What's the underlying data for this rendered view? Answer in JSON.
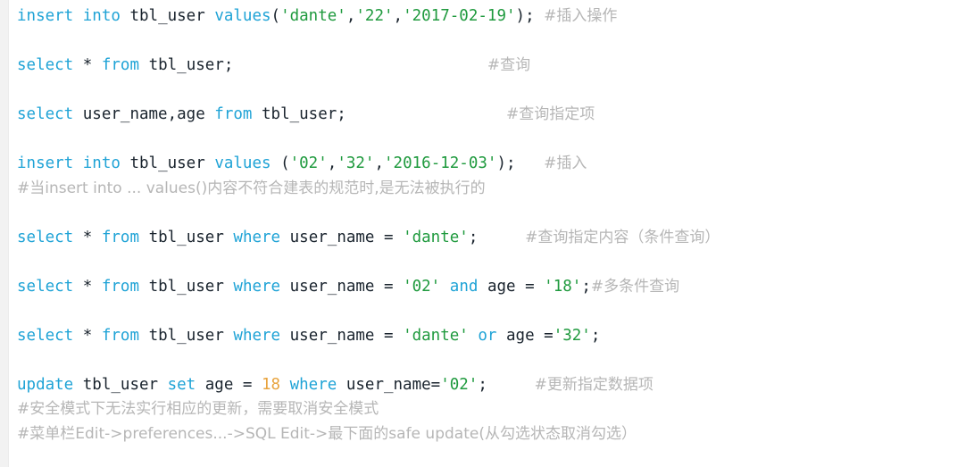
{
  "editor": {
    "language": "sql",
    "colors": {
      "keyword": "#1fa3d6",
      "identifier": "#19232d",
      "string": "#1f9a3e",
      "number": "#e8a33d",
      "comment": "#b6b6b6",
      "background": "#ffffff",
      "gutter": "#f2f2f2"
    }
  },
  "lines": [
    {
      "n": 1,
      "text": "insert into tbl_user values('dante','22','2017-02-19');   #插入操作",
      "tokens": [
        {
          "t": "insert",
          "k": "kw"
        },
        {
          "t": " ",
          "k": "op"
        },
        {
          "t": "into",
          "k": "kw"
        },
        {
          "t": " ",
          "k": "op"
        },
        {
          "t": "tbl_user",
          "k": "id"
        },
        {
          "t": " ",
          "k": "op"
        },
        {
          "t": "values",
          "k": "kw"
        },
        {
          "t": "(",
          "k": "punc"
        },
        {
          "t": "'dante'",
          "k": "str"
        },
        {
          "t": ",",
          "k": "punc"
        },
        {
          "t": "'22'",
          "k": "str"
        },
        {
          "t": ",",
          "k": "punc"
        },
        {
          "t": "'2017-02-19'",
          "k": "str"
        },
        {
          "t": ");",
          "k": "punc"
        },
        {
          "t": " ",
          "k": "op"
        },
        {
          "t": "#插入操作",
          "k": "cmt"
        }
      ]
    },
    {
      "n": 2,
      "text": "",
      "tokens": []
    },
    {
      "n": 3,
      "text": "select * from tbl_user;                              #查询",
      "tokens": [
        {
          "t": "select",
          "k": "kw"
        },
        {
          "t": " ",
          "k": "op"
        },
        {
          "t": "*",
          "k": "op"
        },
        {
          "t": " ",
          "k": "op"
        },
        {
          "t": "from",
          "k": "kw"
        },
        {
          "t": " ",
          "k": "op"
        },
        {
          "t": "tbl_user;",
          "k": "id"
        },
        {
          "t": "                           ",
          "k": "op"
        },
        {
          "t": "#查询",
          "k": "cmt"
        }
      ]
    },
    {
      "n": 4,
      "text": "",
      "tokens": []
    },
    {
      "n": 5,
      "text": "select user_name,age from tbl_user;              #查询指定项",
      "tokens": [
        {
          "t": "select",
          "k": "kw"
        },
        {
          "t": " ",
          "k": "op"
        },
        {
          "t": "user_name",
          "k": "id"
        },
        {
          "t": ",",
          "k": "punc"
        },
        {
          "t": "age",
          "k": "id"
        },
        {
          "t": " ",
          "k": "op"
        },
        {
          "t": "from",
          "k": "kw"
        },
        {
          "t": " ",
          "k": "op"
        },
        {
          "t": "tbl_user;",
          "k": "id"
        },
        {
          "t": "                 ",
          "k": "op"
        },
        {
          "t": "#查询指定项",
          "k": "cmt"
        }
      ]
    },
    {
      "n": 6,
      "text": "",
      "tokens": []
    },
    {
      "n": 7,
      "text": "insert into tbl_user values ('02','32','2016-12-03');   #插入",
      "tokens": [
        {
          "t": "insert",
          "k": "kw"
        },
        {
          "t": " ",
          "k": "op"
        },
        {
          "t": "into",
          "k": "kw"
        },
        {
          "t": " ",
          "k": "op"
        },
        {
          "t": "tbl_user",
          "k": "id"
        },
        {
          "t": " ",
          "k": "op"
        },
        {
          "t": "values",
          "k": "kw"
        },
        {
          "t": " (",
          "k": "punc"
        },
        {
          "t": "'02'",
          "k": "str"
        },
        {
          "t": ",",
          "k": "punc"
        },
        {
          "t": "'32'",
          "k": "str"
        },
        {
          "t": ",",
          "k": "punc"
        },
        {
          "t": "'2016-12-03'",
          "k": "str"
        },
        {
          "t": ");",
          "k": "punc"
        },
        {
          "t": "   ",
          "k": "op"
        },
        {
          "t": "#插入",
          "k": "cmt"
        }
      ]
    },
    {
      "n": 8,
      "text": "#当insert into ... values()内容不符合建表的规范时,是无法被执行的",
      "tokens": [
        {
          "t": "#当insert into ... values()内容不符合建表的规范时,是无法被执行的",
          "k": "cmt"
        }
      ]
    },
    {
      "n": 9,
      "text": "",
      "tokens": []
    },
    {
      "n": 10,
      "text": "select * from tbl_user where user_name = 'dante';    #查询指定内容（条件查询）",
      "tokens": [
        {
          "t": "select",
          "k": "kw"
        },
        {
          "t": " ",
          "k": "op"
        },
        {
          "t": "*",
          "k": "op"
        },
        {
          "t": " ",
          "k": "op"
        },
        {
          "t": "from",
          "k": "kw"
        },
        {
          "t": " ",
          "k": "op"
        },
        {
          "t": "tbl_user",
          "k": "id"
        },
        {
          "t": " ",
          "k": "op"
        },
        {
          "t": "where",
          "k": "kw"
        },
        {
          "t": " ",
          "k": "op"
        },
        {
          "t": "user_name",
          "k": "id"
        },
        {
          "t": " = ",
          "k": "op"
        },
        {
          "t": "'dante'",
          "k": "str"
        },
        {
          "t": ";",
          "k": "punc"
        },
        {
          "t": "     ",
          "k": "op"
        },
        {
          "t": "#查询指定内容（条件查询）",
          "k": "cmt"
        }
      ]
    },
    {
      "n": 11,
      "text": "",
      "tokens": []
    },
    {
      "n": 12,
      "text": "select * from tbl_user where user_name = '02' and age = '18';#多条件查询",
      "tokens": [
        {
          "t": "select",
          "k": "kw"
        },
        {
          "t": " ",
          "k": "op"
        },
        {
          "t": "*",
          "k": "op"
        },
        {
          "t": " ",
          "k": "op"
        },
        {
          "t": "from",
          "k": "kw"
        },
        {
          "t": " ",
          "k": "op"
        },
        {
          "t": "tbl_user",
          "k": "id"
        },
        {
          "t": " ",
          "k": "op"
        },
        {
          "t": "where",
          "k": "kw"
        },
        {
          "t": " ",
          "k": "op"
        },
        {
          "t": "user_name",
          "k": "id"
        },
        {
          "t": " = ",
          "k": "op"
        },
        {
          "t": "'02'",
          "k": "str"
        },
        {
          "t": " ",
          "k": "op"
        },
        {
          "t": "and",
          "k": "kw"
        },
        {
          "t": " ",
          "k": "op"
        },
        {
          "t": "age",
          "k": "id"
        },
        {
          "t": " = ",
          "k": "op"
        },
        {
          "t": "'18'",
          "k": "str"
        },
        {
          "t": ";",
          "k": "punc"
        },
        {
          "t": "#多条件查询",
          "k": "cmt"
        }
      ]
    },
    {
      "n": 13,
      "text": "",
      "tokens": []
    },
    {
      "n": 14,
      "text": "select * from tbl_user where user_name = 'dante' or age ='32';",
      "tokens": [
        {
          "t": "select",
          "k": "kw"
        },
        {
          "t": " ",
          "k": "op"
        },
        {
          "t": "*",
          "k": "op"
        },
        {
          "t": " ",
          "k": "op"
        },
        {
          "t": "from",
          "k": "kw"
        },
        {
          "t": " ",
          "k": "op"
        },
        {
          "t": "tbl_user",
          "k": "id"
        },
        {
          "t": " ",
          "k": "op"
        },
        {
          "t": "where",
          "k": "kw"
        },
        {
          "t": " ",
          "k": "op"
        },
        {
          "t": "user_name",
          "k": "id"
        },
        {
          "t": " = ",
          "k": "op"
        },
        {
          "t": "'dante'",
          "k": "str"
        },
        {
          "t": " ",
          "k": "op"
        },
        {
          "t": "or",
          "k": "kw"
        },
        {
          "t": " ",
          "k": "op"
        },
        {
          "t": "age",
          "k": "id"
        },
        {
          "t": " =",
          "k": "op"
        },
        {
          "t": "'32'",
          "k": "str"
        },
        {
          "t": ";",
          "k": "punc"
        }
      ]
    },
    {
      "n": 15,
      "text": "",
      "tokens": []
    },
    {
      "n": 16,
      "text": "update tbl_user set age = 18 where user_name='02';     #更新指定数据项",
      "tokens": [
        {
          "t": "update",
          "k": "kw"
        },
        {
          "t": " ",
          "k": "op"
        },
        {
          "t": "tbl_user",
          "k": "id"
        },
        {
          "t": " ",
          "k": "op"
        },
        {
          "t": "set",
          "k": "kw"
        },
        {
          "t": " ",
          "k": "op"
        },
        {
          "t": "age",
          "k": "id"
        },
        {
          "t": " = ",
          "k": "op"
        },
        {
          "t": "18",
          "k": "num"
        },
        {
          "t": " ",
          "k": "op"
        },
        {
          "t": "where",
          "k": "kw"
        },
        {
          "t": " ",
          "k": "op"
        },
        {
          "t": "user_name=",
          "k": "id"
        },
        {
          "t": "'02'",
          "k": "str"
        },
        {
          "t": ";",
          "k": "punc"
        },
        {
          "t": "     ",
          "k": "op"
        },
        {
          "t": "#更新指定数据项",
          "k": "cmt"
        }
      ]
    },
    {
      "n": 17,
      "text": "#安全模式下无法实行相应的更新，需要取消安全模式",
      "tokens": [
        {
          "t": "#安全模式下无法实行相应的更新，需要取消安全模式",
          "k": "cmt"
        }
      ]
    },
    {
      "n": 18,
      "text": "#菜单栏Edit->preferences...->SQL Edit->最下面的safe update(从勾选状态取消勾选）",
      "tokens": [
        {
          "t": "#菜单栏Edit->preferences...->SQL Edit->最下面的safe update(从勾选状态取消勾选）",
          "k": "cmt"
        }
      ]
    }
  ]
}
